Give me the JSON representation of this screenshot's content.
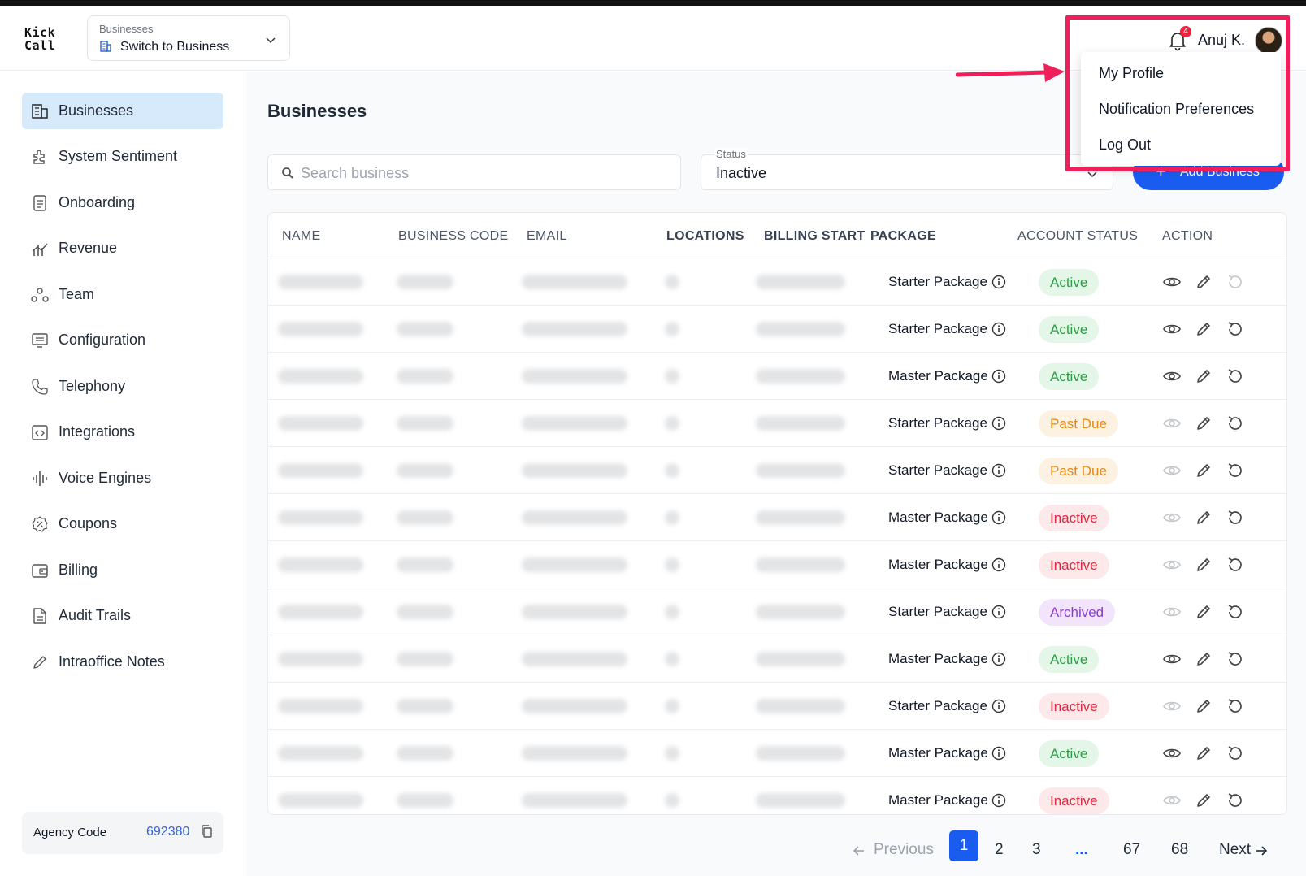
{
  "app": {
    "logo_line1": "Kick",
    "logo_line2": "Call",
    "switcher_label": "Businesses",
    "switcher_value": "Switch to Business",
    "notification_count": "4",
    "user_name": "Anuj K."
  },
  "user_menu": {
    "items": [
      "My Profile",
      "Notification Preferences",
      "Log Out"
    ]
  },
  "sidebar": {
    "items": [
      {
        "label": "Businesses",
        "icon": "building-icon",
        "active": true
      },
      {
        "label": "System Sentiment",
        "icon": "puzzle-icon",
        "active": false
      },
      {
        "label": "Onboarding",
        "icon": "document-icon",
        "active": false
      },
      {
        "label": "Revenue",
        "icon": "chart-icon",
        "active": false
      },
      {
        "label": "Team",
        "icon": "team-icon",
        "active": false
      },
      {
        "label": "Configuration",
        "icon": "configuration-icon",
        "active": false
      },
      {
        "label": "Telephony",
        "icon": "phone-icon",
        "active": false
      },
      {
        "label": "Integrations",
        "icon": "code-icon",
        "active": false
      },
      {
        "label": "Voice Engines",
        "icon": "waveform-icon",
        "active": false
      },
      {
        "label": "Coupons",
        "icon": "coupon-icon",
        "active": false
      },
      {
        "label": "Billing",
        "icon": "wallet-icon",
        "active": false
      },
      {
        "label": "Audit Trails",
        "icon": "file-icon",
        "active": false
      },
      {
        "label": "Intraoffice Notes",
        "icon": "pencil-icon",
        "active": false
      }
    ],
    "agency_code_label": "Agency Code",
    "agency_code_value": "692380"
  },
  "main": {
    "title": "Businesses",
    "search_placeholder": "Search business",
    "status_label": "Status",
    "status_value": "Inactive",
    "add_button_label": "Add Business",
    "columns": [
      "NAME",
      "BUSINESS CODE",
      "EMAIL",
      "LOCATIONS",
      "BILLING START",
      "PACKAGE",
      "ACCOUNT STATUS",
      "ACTION"
    ],
    "rows": [
      {
        "package": "Starter Package",
        "status": "Active"
      },
      {
        "package": "Starter Package",
        "status": "Active"
      },
      {
        "package": "Master Package",
        "status": "Active"
      },
      {
        "package": "Starter Package",
        "status": "Past Due"
      },
      {
        "package": "Starter Package",
        "status": "Past Due"
      },
      {
        "package": "Master Package",
        "status": "Inactive"
      },
      {
        "package": "Master Package",
        "status": "Inactive"
      },
      {
        "package": "Starter Package",
        "status": "Archived"
      },
      {
        "package": "Master Package",
        "status": "Active"
      },
      {
        "package": "Starter Package",
        "status": "Inactive"
      },
      {
        "package": "Master Package",
        "status": "Active"
      },
      {
        "package": "Master Package",
        "status": "Inactive"
      }
    ]
  },
  "pagination": {
    "previous": "Previous",
    "pages": [
      "1",
      "2",
      "3",
      "...",
      "67",
      "68"
    ],
    "current": "1",
    "next": "Next"
  },
  "colors": {
    "accent": "#1a5cf0",
    "highlight": "#ef1f5c",
    "active_bg": "#e3f6e7",
    "active_fg": "#2e9a46",
    "pastdue_bg": "#fdf1e1",
    "pastdue_fg": "#e08a1e",
    "inactive_bg": "#fde8ea",
    "inactive_fg": "#e1263f",
    "archived_bg": "#f1e4fb",
    "archived_fg": "#8a3fcf"
  }
}
